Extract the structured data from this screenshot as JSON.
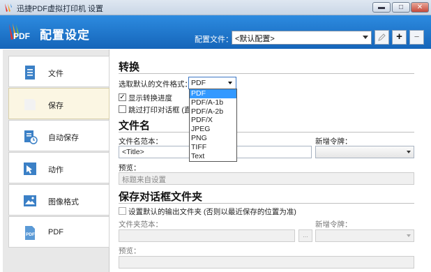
{
  "window": {
    "title": "迅捷PDF虚拟打印机 设置",
    "minimize": "▬",
    "maximize": "□",
    "close": "✕"
  },
  "header": {
    "title": "配置设定",
    "logo_text": "PDF",
    "profile_label": "配置文件：",
    "profile_value": "<默认配置>",
    "add_label": "+",
    "remove_label": "−"
  },
  "sidebar": {
    "items": [
      {
        "label": "文件",
        "icon": "document-icon"
      },
      {
        "label": "保存",
        "icon": "save-icon",
        "active": true
      },
      {
        "label": "自动保存",
        "icon": "auto-save-icon"
      },
      {
        "label": "动作",
        "icon": "action-icon"
      },
      {
        "label": "图像格式",
        "icon": "image-icon"
      },
      {
        "label": "PDF",
        "icon": "pdf-icon"
      }
    ]
  },
  "convert": {
    "title": "转换",
    "format_label": "选取默认的文件格式：",
    "format_value": "PDF",
    "show_progress_label": "显示转换进度",
    "show_progress_checked": true,
    "skip_dialog_label": "跳过打印对话框 (直接",
    "skip_dialog_checked": false,
    "format_options": [
      "PDF",
      "PDF/A-1b",
      "PDF/A-2b",
      "PDF/X",
      "JPEG",
      "PNG",
      "TIFF",
      "Text"
    ]
  },
  "filename": {
    "title": "文件名",
    "template_label": "文件名范本：",
    "template_value": "<Title>",
    "token_label": "新增令牌：",
    "preview_label": "预览：",
    "preview_value": "标题来自设置"
  },
  "savedialog": {
    "title": "保存对话框文件夹",
    "default_folder_label": "设置默认的输出文件夹 (否则以最近保存的位置为准)",
    "folder_template_label": "文件夹范本：",
    "token_label": "新增令牌：",
    "browse_label": "...",
    "preview_label": "预览："
  },
  "colors": {
    "header_top": "#2d8be0",
    "header_bottom": "#1565b9",
    "selection": "#3399ff",
    "active_nav": "#fbf6e3"
  }
}
